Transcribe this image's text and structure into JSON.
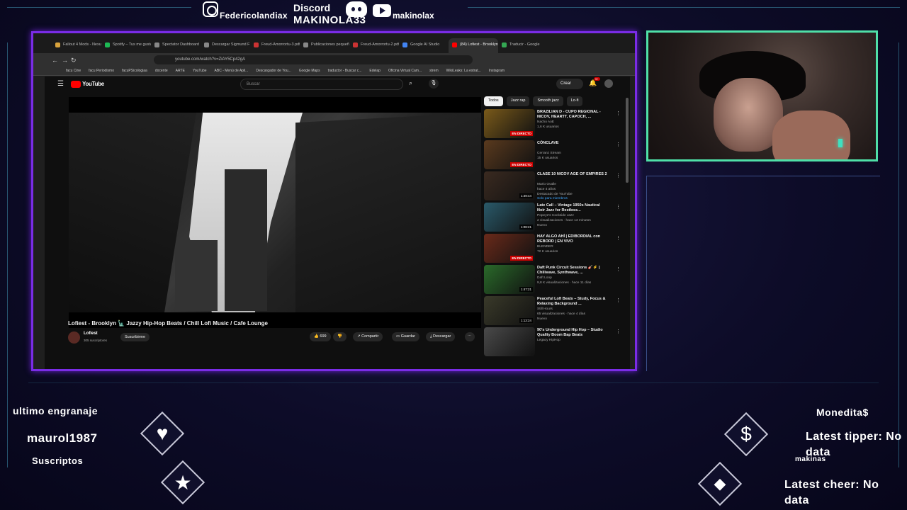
{
  "overlay": {
    "instagram_handle": "Federicolandiax",
    "discord_label": "Discord",
    "discord_name": "MAKINOLA33",
    "youtube_handle": "makinolax",
    "last_follower_label": "ultimo engranaje",
    "last_follower_name": "maurol1987",
    "subscribers_label": "Suscriptos",
    "coins_label": "Monedita$",
    "latest_tipper": "Latest tipper: No data",
    "latest_cheer": "Latest cheer: No data",
    "small_label": "makinas",
    "accent_color": "#7a2ce6",
    "cam_border_color": "#4fe0a8"
  },
  "browser": {
    "tabs": [
      {
        "label": "Fallout 4 Mods - Nexu",
        "color": "#d8a23c"
      },
      {
        "label": "Spotify – Tus me gusta",
        "color": "#1db954"
      },
      {
        "label": "Spectator Dashboard",
        "color": "#888"
      },
      {
        "label": "Descargar Sigmund F",
        "color": "#888"
      },
      {
        "label": "Freud-Amorrortu-3.pdf",
        "color": "#c33"
      },
      {
        "label": "Publicaciones pequeñas",
        "color": "#888"
      },
      {
        "label": "Freud-Amorrortu-2.pdf",
        "color": "#c33"
      },
      {
        "label": "Google AI Studio",
        "color": "#4285f4"
      },
      {
        "label": "(84) Lofiest - Brooklyn",
        "color": "#f00",
        "active": true
      },
      {
        "label": "Traducir - Google",
        "color": "#34a853"
      }
    ],
    "url": "youtube.com/watch?v=ZiAY5Cp42gA",
    "bookmarks": [
      "facu Cine",
      "facu Periodismo",
      "facuPSicologiaa",
      "docente",
      "ARTE",
      "YouTube",
      "ABC - Menú de Apli...",
      "Descargador de You...",
      "Google Maps",
      "traductor - Buscar c...",
      "Edelap",
      "Oficina Virtual Cam...",
      "strem",
      "WikiLeaks: La estrat...",
      "Instagram"
    ]
  },
  "youtube": {
    "logo": "YouTube",
    "search_placeholder": "Buscar",
    "create_label": "Crear",
    "notif_count": "9+",
    "video_title": "Lofiest - Brooklyn 🗽 Jazzy Hip-Hop Beats / Chill Lofi Music / Cafe Lounge",
    "channel_name": "Lofiest",
    "channel_subs": "305 suscriptores",
    "subscribe_label": "Suscribirme",
    "likes": "699",
    "share_label": "Compartir",
    "save_label": "Guardar",
    "download_label": "Descargar",
    "chips": [
      "Todos",
      "Jazz rap",
      "Smooth jazz",
      "Lo-fi"
    ],
    "recommendations": [
      {
        "title": "BRAZILIAN D - CUPO REGIONAL - NICOV, HEARTT, CAPOCH, ...",
        "channel": "Nacho AoE",
        "meta": "1,6 K usuarios",
        "badge": "EN DIRECTO",
        "live": true,
        "thumb": "#7a5a1a"
      },
      {
        "title": "CÓNCLAVE",
        "channel": "Cerranz Stream",
        "meta": "15 K usuarios",
        "badge": "EN DIRECTO",
        "live": true,
        "thumb": "#5a3a1e"
      },
      {
        "title": "CLASE 10 NICOV AGE OF EMPIRES 2",
        "channel": "Mario Ovalle",
        "meta": "hace 4 años",
        "extra": "Destacado de YouTube",
        "extra2": "Solo para miembros",
        "badge": "1:49:44",
        "live": false,
        "thumb": "#3a2a20"
      },
      {
        "title": "Late Call – Vintage 1950s Nautical Noir Jazz for Restless...",
        "channel": "Popeye's Cockside Jazz",
        "meta": "2 visualizaciones · hace 13 minutos",
        "extra": "Nuevo",
        "badge": "1:08:21",
        "live": false,
        "thumb": "#2a5a6a"
      },
      {
        "title": "HAY ALGO AHÍ | EDIBORDIAL con REBORD | EN VIVO",
        "channel": "BLENDER",
        "meta": "72 K usuarios",
        "badge": "EN DIRECTO",
        "live": true,
        "thumb": "#6a2a1a"
      },
      {
        "title": "Daft Punk Circuit Sessions 🎸⚡ | Chillwave, Synthwave, ...",
        "channel": "Daft Loop",
        "meta": "9,8 K visualizaciones · hace 11 días",
        "badge": "1:47:21",
        "live": false,
        "thumb": "#2a6a2a"
      },
      {
        "title": "Peaceful Lofi Beats – Study, Focus & Relaxing Background ...",
        "channel": "Still Hours",
        "meta": "65 visualizaciones · hace 4 días",
        "extra": "Nuevo",
        "badge": "1:13:24",
        "live": false,
        "thumb": "#3a3a2a"
      },
      {
        "title": "90's Underground Hip Hop – Studio Quality Boom Bap Beats",
        "channel": "Legacy HipHop",
        "meta": "",
        "badge": "",
        "live": false,
        "thumb": "#4a4a4a"
      }
    ]
  }
}
